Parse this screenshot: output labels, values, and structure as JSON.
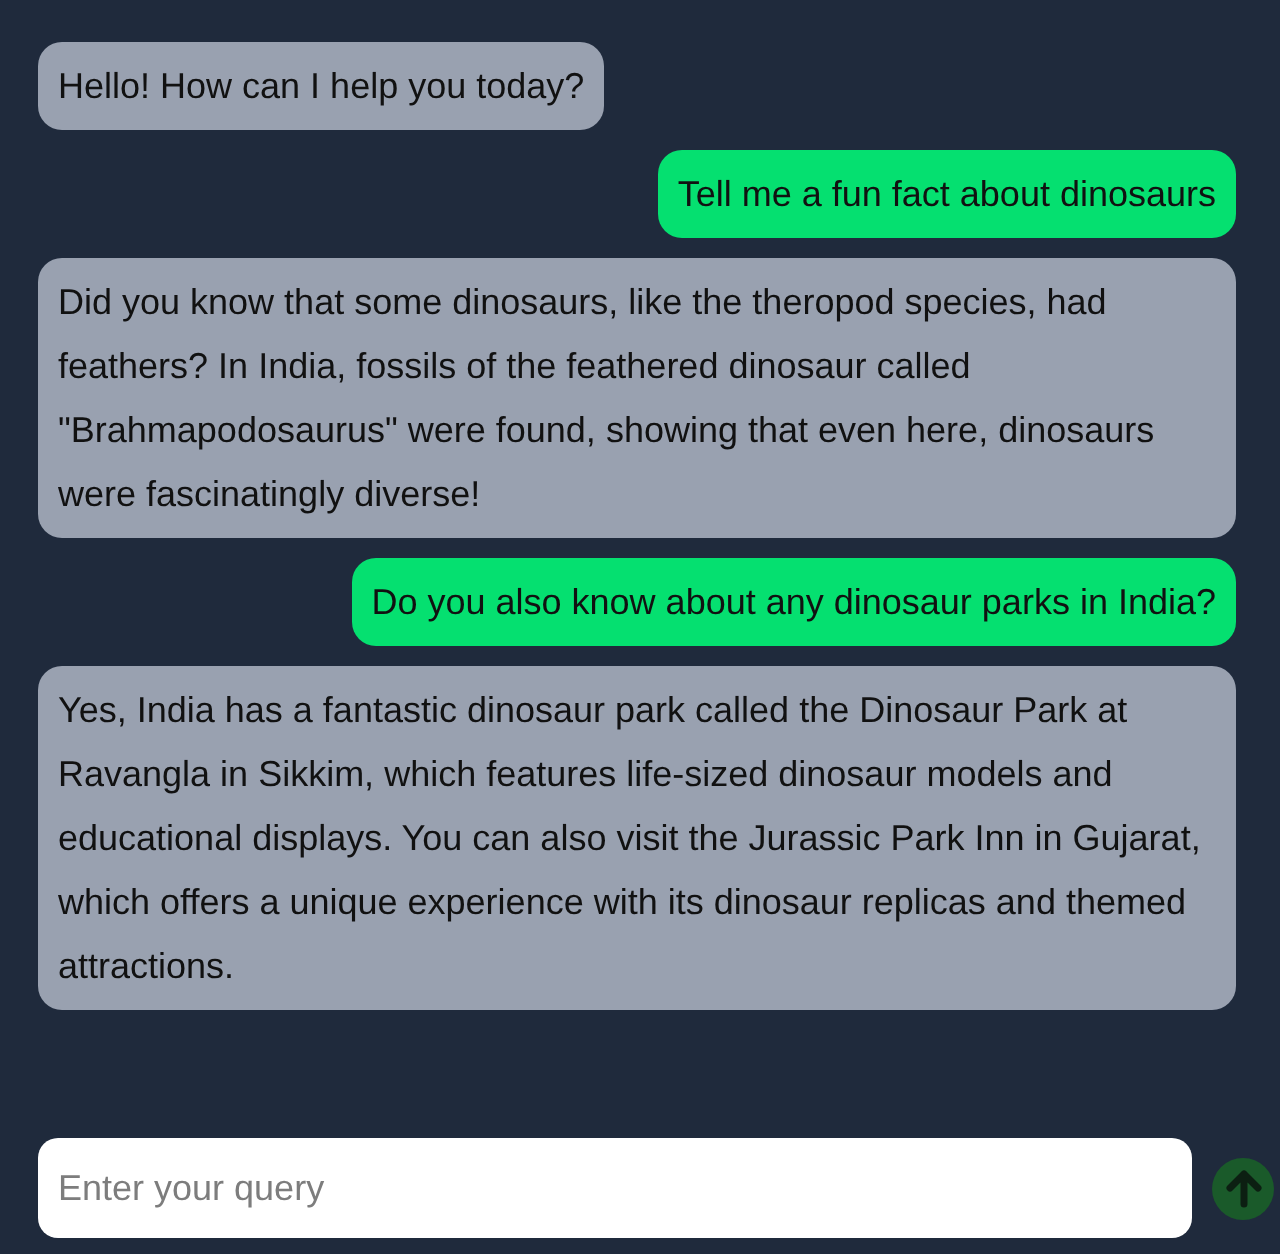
{
  "messages": [
    {
      "kind": "bot",
      "text": "Hello! How can I help you today?"
    },
    {
      "kind": "user",
      "text": "Tell me a fun fact about dinosaurs"
    },
    {
      "kind": "bot",
      "text": "Did you know that some dinosaurs, like the theropod species, had feathers? In India, fossils of the feathered dinosaur called \"Brahmapodosaurus\" were found, showing that even here, dinosaurs were fascinatingly diverse!"
    },
    {
      "kind": "user",
      "text": "Do you also know about any dinosaur parks in India?"
    },
    {
      "kind": "bot",
      "text": "Yes, India has a fantastic dinosaur park called the Dinosaur Park at Ravangla in Sikkim, which features life-sized dinosaur models and educational displays. You can also visit the Jurassic Park Inn in Gujarat, which offers a unique experience with its dinosaur replicas and themed attractions."
    }
  ],
  "composer": {
    "placeholder": "Enter your query"
  }
}
